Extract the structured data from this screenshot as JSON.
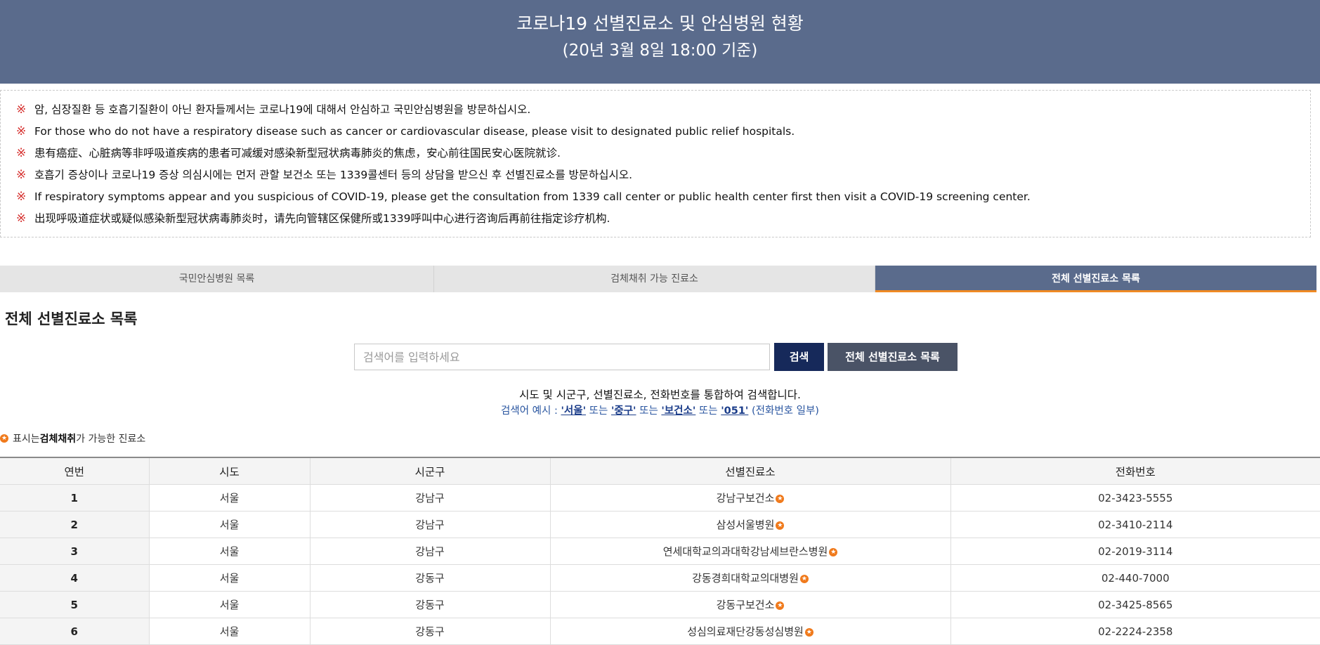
{
  "header": {
    "title": "코로나19 선별진료소 및 안심병원 현황",
    "subtitle": "(20년 3월 8일 18:00 기준)"
  },
  "notices": [
    "암, 심장질환 등 호흡기질환이 아닌 환자들께서는 코로나19에 대해서 안심하고 국민안심병원을 방문하십시오.",
    "For those who do not have a respiratory disease such as cancer or cardiovascular disease, please visit to designated public relief hospitals.",
    "患有癌症、心脏病等非呼吸道疾病的患者可减缓对感染新型冠状病毒肺炎的焦虑，安心前往国民安心医院就诊.",
    "호흡기 증상이나 코로나19 증상 의심시에는 먼저 관할 보건소 또는 1339콜센터 등의 상담을 받으신 후 선별진료소를 방문하십시오.",
    "If respiratory symptoms appear and you suspicious of COVID-19, please get the consultation from 1339 call center or public health center first then visit a COVID-19 screening center.",
    "出现呼吸道症状或疑似感染新型冠状病毒肺炎时，请先向管辖区保健所或1339呼叫中心进行咨询后再前往指定诊疗机构."
  ],
  "notice_mark": "※",
  "tabs": [
    {
      "label": "국민안심병원 목록"
    },
    {
      "label": "검체채취 가능 진료소"
    },
    {
      "label": "전체 선별진료소 목록"
    }
  ],
  "section_title": "전체 선별진료소 목록",
  "search": {
    "placeholder": "검색어를 입력하세요",
    "value": "",
    "button": "검색",
    "all_button": "전체 선별진료소 목록"
  },
  "help": {
    "line1": "시도 및 시군구, 선별진료소, 전화번호를 통합하여 검색합니다.",
    "prefix": "검색어 예시 : ",
    "examples": [
      "'서울'",
      "'중구'",
      "'보건소'",
      "'051'"
    ],
    "or1": " 또는 ",
    "or2": " 또는 ",
    "or3": " 또는 ",
    "suffix": " (전화번호 일부)"
  },
  "legend": {
    "before": "표시는 ",
    "bold": "검체채취",
    "after": "가 가능한 진료소"
  },
  "sample_icon_glyph": "★",
  "table": {
    "headers": [
      "연번",
      "시도",
      "시군구",
      "선별진료소",
      "전화번호"
    ],
    "rows": [
      {
        "no": "1",
        "sido": "서울",
        "sigungu": "강남구",
        "clinic": "강남구보건소",
        "phone": "02-3423-5555",
        "sample": true
      },
      {
        "no": "2",
        "sido": "서울",
        "sigungu": "강남구",
        "clinic": "삼성서울병원",
        "phone": "02-3410-2114",
        "sample": true
      },
      {
        "no": "3",
        "sido": "서울",
        "sigungu": "강남구",
        "clinic": "연세대학교의과대학강남세브란스병원",
        "phone": "02-2019-3114",
        "sample": true
      },
      {
        "no": "4",
        "sido": "서울",
        "sigungu": "강동구",
        "clinic": "강동경희대학교의대병원",
        "phone": "02-440-7000",
        "sample": true
      },
      {
        "no": "5",
        "sido": "서울",
        "sigungu": "강동구",
        "clinic": "강동구보건소",
        "phone": "02-3425-8565",
        "sample": true
      },
      {
        "no": "6",
        "sido": "서울",
        "sigungu": "강동구",
        "clinic": "성심의료재단강동성심병원",
        "phone": "02-2224-2358",
        "sample": true
      }
    ]
  },
  "colors": {
    "header_bg": "#5a6b8c",
    "active_tab_underline": "#f08a24",
    "search_button": "#16295a",
    "sample_icon": "#f07a1c",
    "notice_mark": "#d6312f"
  }
}
